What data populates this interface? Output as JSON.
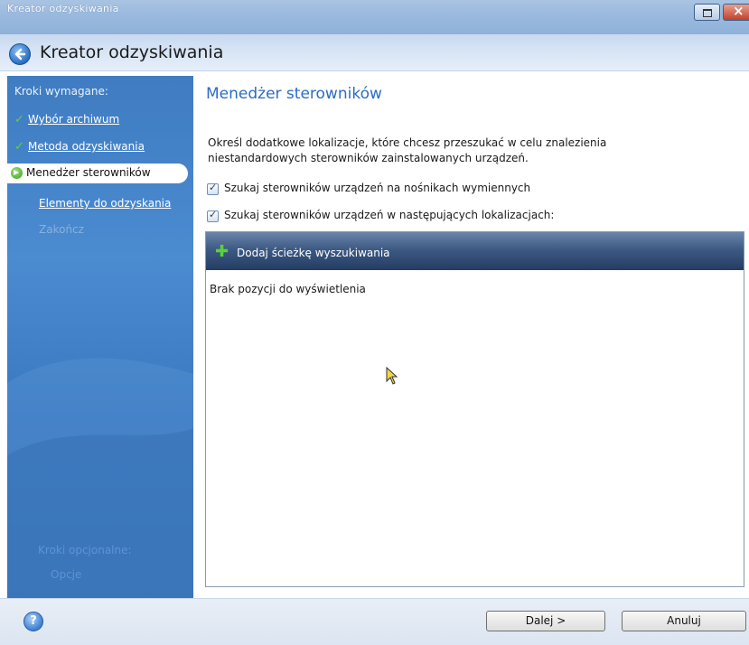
{
  "window": {
    "title": "Kreator odzyskiwania"
  },
  "header": {
    "title": "Kreator odzyskiwania"
  },
  "sidebar": {
    "required_heading": "Kroki wymagane:",
    "items": [
      {
        "label": "Wybór archiwum",
        "state": "done"
      },
      {
        "label": "Metoda odzyskiwania",
        "state": "done"
      },
      {
        "label": "Menedżer sterowników",
        "state": "active"
      },
      {
        "label": "Elementy do odzyskania",
        "state": "link"
      },
      {
        "label": "Zakończ",
        "state": "disabled"
      }
    ],
    "optional_heading": "Kroki opcjonalne:",
    "optional_items": [
      "Opcje"
    ]
  },
  "main": {
    "title": "Menedżer sterowników",
    "description": "Określ dodatkowe lokalizacje, które chcesz przeszukać w celu znalezienia niestandardowych sterowników zainstalowanych urządzeń.",
    "checkboxes": [
      {
        "label": "Szukaj sterowników urządzeń na nośnikach wymiennych",
        "checked": true
      },
      {
        "label": "Szukaj sterowników urządzeń w następujących lokalizacjach:",
        "checked": true
      }
    ],
    "add_path_label": "Dodaj ścieżkę wyszukiwania",
    "empty_message": "Brak pozycji do wyświetlenia"
  },
  "footer": {
    "next_label": "Dalej >",
    "cancel_label": "Anuluj"
  },
  "colors": {
    "accent": "#2b6cc4",
    "sidebar": "#3f7cc2",
    "toolbar": "#2c4468",
    "check": "#5fd13a"
  },
  "icons": [
    "back-arrow-icon",
    "check-icon",
    "arrow-right-icon",
    "plus-icon",
    "help-icon",
    "restore-icon",
    "close-icon"
  ]
}
